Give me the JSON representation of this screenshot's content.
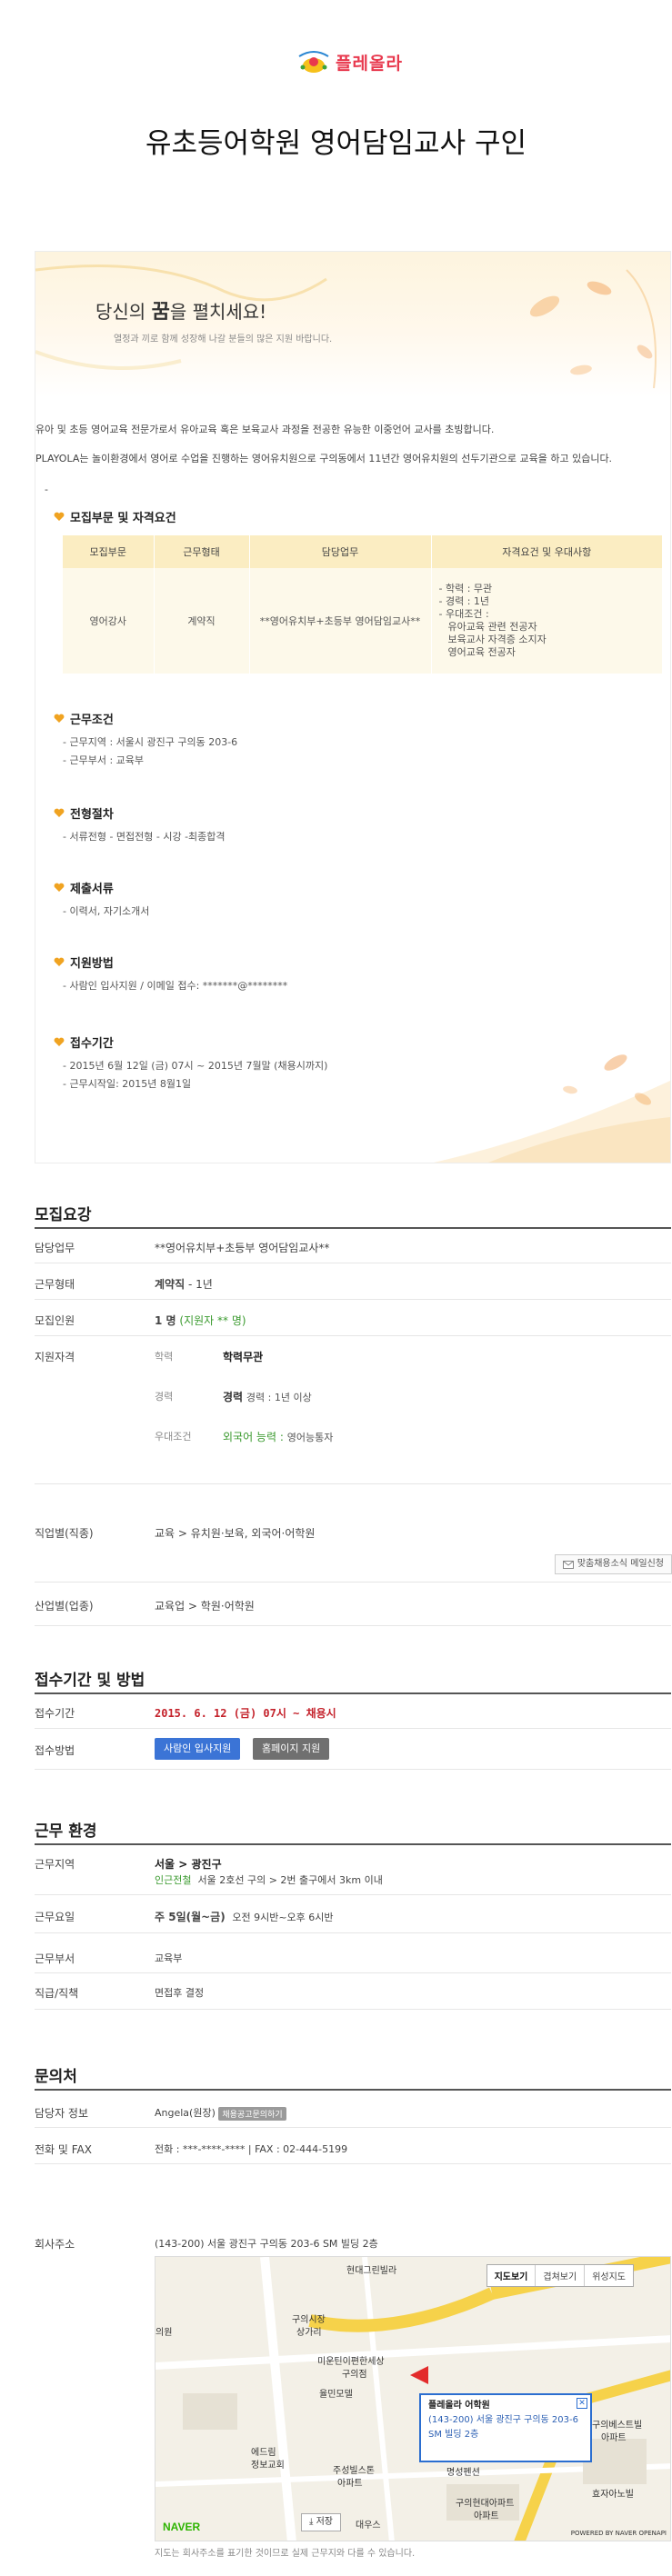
{
  "header": {
    "logo_text": "플레올라",
    "page_title": "유초등어학원 영어담임교사 구인"
  },
  "poster": {
    "banner_title_prefix": "당신의 ",
    "banner_title_emph": "꿈",
    "banner_title_suffix": "을 펼치세요!",
    "banner_subtitle": "열정과 끼로 함께 성장해 나갈 분들의 많은 지원 바랍니다.",
    "intro_1": "유아 및 초등 영어교육 전문가로서 유아교육 혹은 보육교사 과정을 전공한 유능한 이중언어 교사를 초빙합니다.",
    "intro_2": "PLAYOLA는 놀이환경에서 영어로 수업을 진행하는 영어유치원으로 구의동에서 11년간 영어유치원의 선두기관으로 교육을 하고 있습니다.",
    "intro_dash": "-",
    "section_recruit": "모집부문 및 자격요건",
    "table_headers": [
      "모집부문",
      "근무형태",
      "담당업무",
      "자격요건 및 우대사항"
    ],
    "table_row": {
      "dept": "영어강사",
      "type": "계약직",
      "duty": "**영어유치부+초등부 영어담임교사**",
      "qualifications": [
        "- 학력 : 무관",
        "- 경력 : 1년",
        "- 우대조건 :",
        "   유아교육 관련 전공자",
        "   보육교사 자격증 소지자",
        "   영어교육 전공자"
      ]
    },
    "section_work": "근무조건",
    "work_items": [
      "- 근무지역 : 서울시 광진구 구의동 203-6",
      "- 근무부서 : 교육부"
    ],
    "section_process": "전형절차",
    "process_items": [
      "- 서류전형 - 면접전형 - 시강 -최종합격"
    ],
    "section_docs": "제출서류",
    "docs_items": [
      "- 이력서, 자기소개서"
    ],
    "section_apply": "지원방법",
    "apply_items": [
      "- 사람인 입사지원 / 이메일 접수: *******@********"
    ],
    "section_period": "접수기간",
    "period_items": [
      "- 2015년 6월 12일 (금) 07시 ~ 2015년 7월말 (채용시까지)",
      "- 근무시작일: 2015년 8월1일"
    ]
  },
  "recruit_summary": {
    "title": "모집요강",
    "duty_label": "담당업무",
    "duty_value": "**영어유치부+초등부 영어담임교사**",
    "type_label": "근무형태",
    "type_value": "계약직",
    "type_extra": " - 1년",
    "count_label": "모집인원",
    "count_value": "1 명",
    "count_extra": "(지원자 ** 명)",
    "qual_label": "지원자격",
    "edu_label": "학력",
    "edu_value": "학력무관",
    "career_label": "경력",
    "career_value": "경력",
    "career_extra": "경력 : 1년 이상",
    "pref_label": "우대조건",
    "pref_value": "외국어 능력",
    "pref_sep": ":",
    "pref_extra": "영어능통자",
    "job_label": "직업별(직종)",
    "job_value": "교육 > 유치원·보육, 외국어·어학원",
    "custom_btn": "맞춤채용소식 메일신청",
    "industry_label": "산업별(업종)",
    "industry_value": "교육업 > 학원·어학원"
  },
  "apply_section": {
    "title": "접수기간 및 방법",
    "period_label": "접수기간",
    "period_value": "2015. 6. 12 (금) 07시 ~ 채용시",
    "method_label": "접수방법",
    "btn_saramin": "사람인 입사지원",
    "btn_homepage": "홈페이지 지원"
  },
  "environment": {
    "title": "근무 환경",
    "region_label": "근무지역",
    "region_value": "서울 > 광진구",
    "station_label": "인근전철",
    "station_value": "서울 2호선 구의 > 2번 출구에서 3km 이내",
    "days_label": "근무요일",
    "days_value": "주 5일(월~금)",
    "days_extra": "오전 9시반~오후 6시반",
    "dept_label": "근무부서",
    "dept_value": "교육부",
    "salary_label": "직급/직책",
    "salary_value": "면접후 결정"
  },
  "contact": {
    "title": "문의처",
    "manager_label": "담당자 정보",
    "manager_value": "Angela(원장)",
    "manager_tag": "채용공고문의하기",
    "phone_label": "전화 및 FAX",
    "phone_value": "전화 : ***-****-**** | FAX : 02-444-5199",
    "address_label": "회사주소",
    "address_value": "(143-200) 서울 광진구 구의동 203-6 SM 빌딩 2층"
  },
  "map": {
    "type_buttons": [
      "지도보기",
      "겹쳐보기",
      "위성지도"
    ],
    "popup_title": "플레올라 어학원",
    "popup_addr_1": "(143-200) 서울 광진구 구의동 203-6",
    "popup_addr_2": "SM 빌딩 2층",
    "labels": [
      "현대그린빌라",
      "구의시장",
      "상가리",
      "의원",
      "미운틴이편한세상",
      "구의점",
      "율민모델",
      "에드림",
      "정보교회",
      "주성빌스톤",
      "아파트",
      "명성펜션",
      "구의현대아파트",
      "아파트",
      "효자아노빌",
      "대우스",
      "구의베스트빌",
      "아파트"
    ],
    "save_label": "저장",
    "naver_label": "NAVER",
    "powered_label": "POWERED BY NAVER OPENAPI",
    "footnote": "지도는 회사주소를 표기한 것이므로 실제 근무지와 다를 수 있습니다."
  },
  "colors": {
    "accent_orange": "#f0a321",
    "apply_red": "#c4222b",
    "button_blue": "#3b74d6",
    "button_gray": "#707070"
  }
}
